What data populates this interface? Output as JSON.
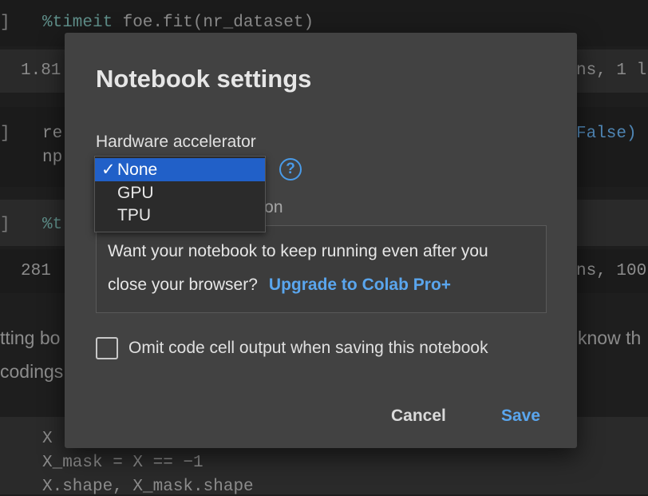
{
  "background": {
    "line1_prompt": "]",
    "line1_magic": "%timeit",
    "line1_code": " foe.fit(nr_dataset)",
    "line2_left": "1.81",
    "line2_right": "ns, 1 l",
    "line3_prompt": "]",
    "line3_code": "re",
    "line3_false": "False)",
    "line4_code": "np",
    "line5_prompt": "]",
    "line5_magic": "%t",
    "line6_left": "281",
    "line6_right": "ns, 100",
    "prose1_left": "tting bo",
    "prose1_right": "know th",
    "prose2_left": "codings",
    "code_bottom1": "X",
    "code_bottom2": "X_mask = X == −1",
    "code_bottom3": "X.shape, X_mask.shape"
  },
  "modal": {
    "title": "Notebook settings",
    "hardware_label": "Hardware accelerator",
    "help_icon": "?",
    "partial_label": "ution",
    "promo_line1": "Want your notebook to keep running even after you",
    "promo_line2": "close your browser?",
    "promo_link": "Upgrade to Colab Pro+",
    "omit_label": "Omit code cell output when saving this notebook",
    "cancel_label": "Cancel",
    "save_label": "Save"
  },
  "dropdown": {
    "check_mark": "✓",
    "options": [
      {
        "label": "None",
        "selected": true
      },
      {
        "label": "GPU",
        "selected": false
      },
      {
        "label": "TPU",
        "selected": false
      }
    ]
  },
  "colors": {
    "accent": "#5aa6ee",
    "selected_option": "#2160c8",
    "modal_bg": "#424242"
  }
}
